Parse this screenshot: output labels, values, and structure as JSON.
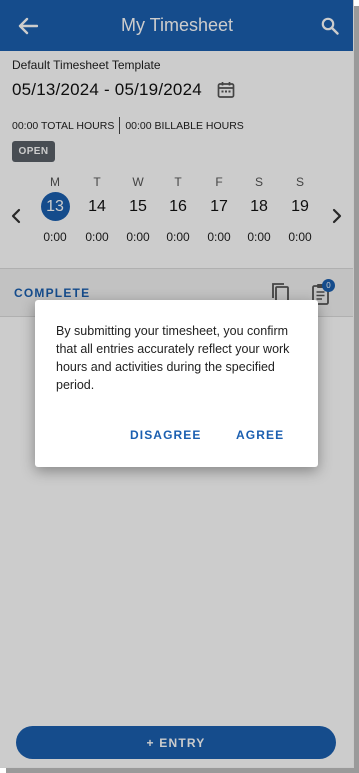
{
  "app_bar": {
    "title": "My Timesheet",
    "back_icon": "arrow-left-icon",
    "search_icon": "search-icon",
    "color": "#1b5fb0"
  },
  "timesheet": {
    "template_name": "Default Timesheet Template",
    "date_range": "05/13/2024 - 05/19/2024",
    "total_hours": "00:00 TOTAL HOURS",
    "billable_hours": "00:00 BILLABLE HOURS",
    "status": "OPEN"
  },
  "week": {
    "days": [
      {
        "letter": "M",
        "date": "13",
        "hours": "0:00",
        "selected": true
      },
      {
        "letter": "T",
        "date": "14",
        "hours": "0:00",
        "selected": false
      },
      {
        "letter": "W",
        "date": "15",
        "hours": "0:00",
        "selected": false
      },
      {
        "letter": "T",
        "date": "16",
        "hours": "0:00",
        "selected": false
      },
      {
        "letter": "F",
        "date": "17",
        "hours": "0:00",
        "selected": false
      },
      {
        "letter": "S",
        "date": "18",
        "hours": "0:00",
        "selected": false
      },
      {
        "letter": "S",
        "date": "19",
        "hours": "0:00",
        "selected": false
      }
    ]
  },
  "actions": {
    "complete_label": "COMPLETE",
    "attachment_count": "0",
    "entry_label": "+ ENTRY"
  },
  "dialog": {
    "message": "By submitting your timesheet, you confirm that all entries accurately reflect your work hours and activities during the specified period.",
    "disagree_label": "DISAGREE",
    "agree_label": "AGREE"
  }
}
